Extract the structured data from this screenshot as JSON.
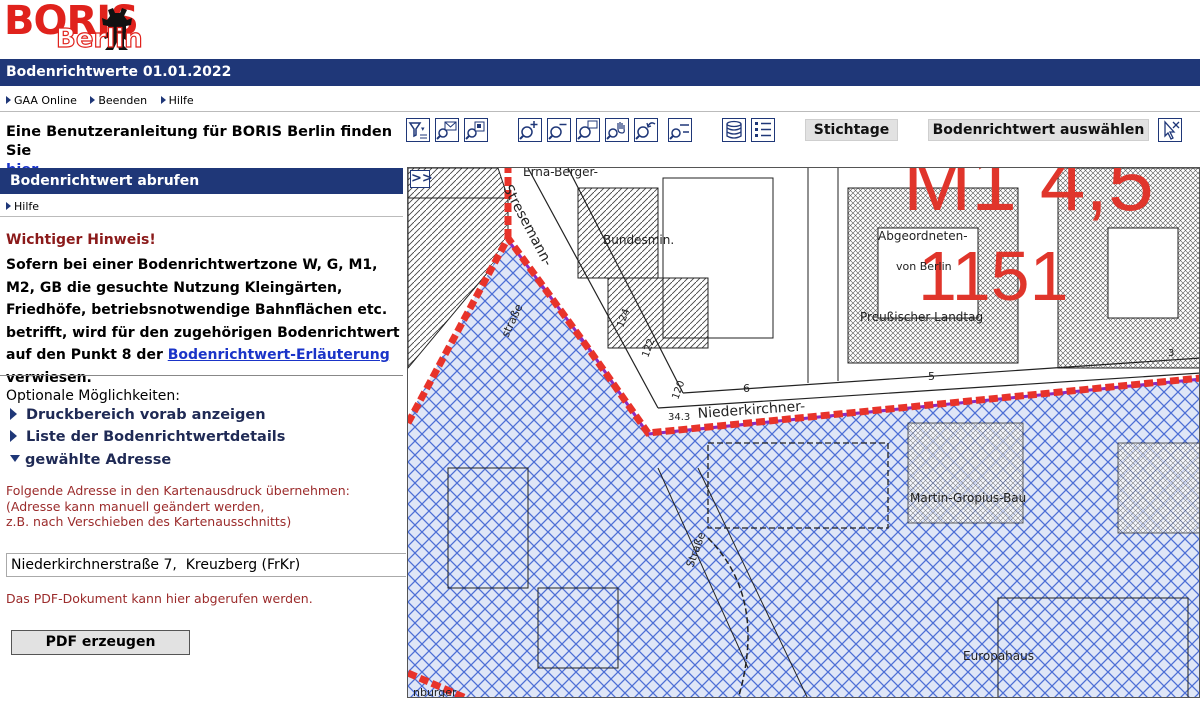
{
  "logo": {
    "main": "BORIS",
    "sub": "Berlin"
  },
  "titlebar": {
    "title": "Bodenrichtwerte 01.01.2022"
  },
  "topnav": {
    "items": [
      "GAA Online",
      "Beenden",
      "Hilfe"
    ]
  },
  "instruction": {
    "text": "Eine Benutzeranleitung für BORIS Berlin finden Sie",
    "link": "hier"
  },
  "toolbar": {
    "icons": [
      "filter-icon",
      "zoom-mail-icon",
      "zoom-previous-icon",
      "zoom-in-icon",
      "zoom-out-icon",
      "zoom-box-icon",
      "pan-icon",
      "zoom-back-icon",
      "zoom-full-icon",
      "layers-icon",
      "legend-icon",
      "cursor-info-icon"
    ],
    "stichtage_label": "Stichtage",
    "select_label": "Bodenrichtwert auswählen"
  },
  "panel": {
    "title": "Bodenrichtwert abrufen",
    "help": "Hilfe",
    "notice_title": "Wichtiger Hinweis!",
    "notice_text": "Sofern bei einer Bodenrichtwertzone W, G, M1, M2, GB die gesuchte Nutzung Kleingärten, Friedhöfe, betriebsnotwendige Bahnflächen etc. betrifft, wird für den zugehörigen Bodenrichtwert auf den Punkt 8 der",
    "notice_link": "Bodenrichtwert-Erläuterung",
    "notice_tail": "verwiesen.",
    "options_title": "Optionale Möglichkeiten:",
    "options": [
      "Druckbereich vorab anzeigen",
      "Liste der Bodenrichtwertdetails",
      "gewählte Adresse"
    ],
    "address_hint": [
      "Folgende Adresse in den Kartenausdruck übernehmen:",
      "(Adresse kann manuell geändert werden,",
      "z.B. nach Verschieben des Kartenausschnitts)"
    ],
    "address_value": "Niederkirchnerstraße 7,  Kreuzberg (FrKr)",
    "pdf_hint": "Das PDF-Dokument kann hier abgerufen werden.",
    "pdf_button": "PDF erzeugen"
  },
  "map": {
    "expand": ">>",
    "zone_label": "M1 4,5",
    "zone_value": "1151",
    "labels": [
      "Erna-Berger-",
      "Bundesmin.",
      "Abgeordneten-",
      "von Berlin",
      "Preußischer Landtag",
      "Niederkirchner-",
      "Martin-Gropius-Bau",
      "Europahaus",
      "Stresemann-",
      "straße",
      "Straße",
      "nburger"
    ],
    "numbers": [
      "6",
      "5",
      "120",
      "34.3",
      "124",
      "122",
      "3"
    ],
    "colors": {
      "hatch": "#4d6fd6",
      "zone_border": "#e8332a",
      "zone_text": "#e0352b",
      "fill": "#b7c7ec",
      "purple": "#8a2bc2"
    }
  }
}
